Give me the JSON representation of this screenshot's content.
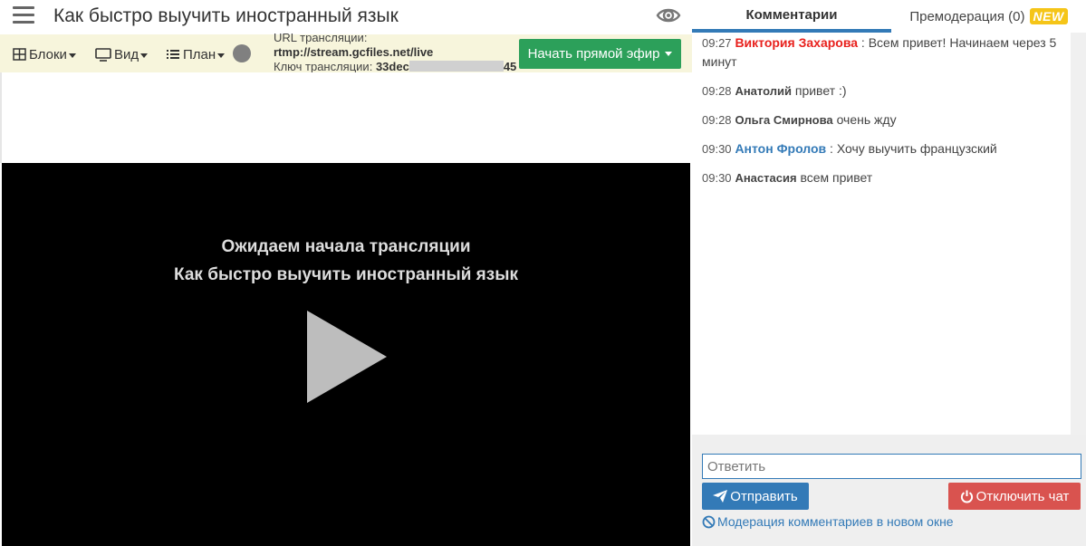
{
  "header": {
    "title": "Как быстро выучить иностранный язык",
    "menu_icon": "hamburger-icon",
    "preview_icon": "eye-icon"
  },
  "toolbar": {
    "blocks_label": "Блоки",
    "view_label": "Вид",
    "plan_label": "План",
    "stream_url_label": "URL трансляции:",
    "stream_url_value": "rtmp://stream.gcfiles.net/live",
    "stream_key_label": "Ключ трансляции:",
    "stream_key_prefix": "33dec",
    "stream_key_suffix": "45",
    "go_live_label": "Начать прямой эфир",
    "go_live_color": "#2ca05a"
  },
  "player": {
    "status_text": "Ожидаем начала трансляции",
    "title": "Как быстро выучить иностранный язык"
  },
  "chat": {
    "tabs": [
      {
        "label": "Комментарии"
      },
      {
        "label": "Премодерация (0)",
        "badge": "NEW"
      }
    ],
    "comments": [
      {
        "time": "09:27",
        "author": "Виктория Захарова",
        "sep": " : ",
        "text": "Всем привет! Начинаем через 5 минут"
      },
      {
        "time": "09:28",
        "author": "Анатолий",
        "sep": " ",
        "text": "привет :)"
      },
      {
        "time": "09:28",
        "author": "Ольга Смирнова",
        "sep": " ",
        "text": "очень жду"
      },
      {
        "time": "09:30",
        "author": "Антон Фролов",
        "sep": " : ",
        "text": "Хочу выучить французский"
      },
      {
        "time": "09:30",
        "author": "Анастасия",
        "sep": " ",
        "text": "всем привет"
      }
    ],
    "reply_placeholder": "Ответить",
    "send_label": "Отправить",
    "disable_label": "Отключить чат",
    "moderation_link": "Модерация комментариев в новом окне",
    "accent_color": "#337ab7",
    "danger_color": "#d9534f"
  }
}
